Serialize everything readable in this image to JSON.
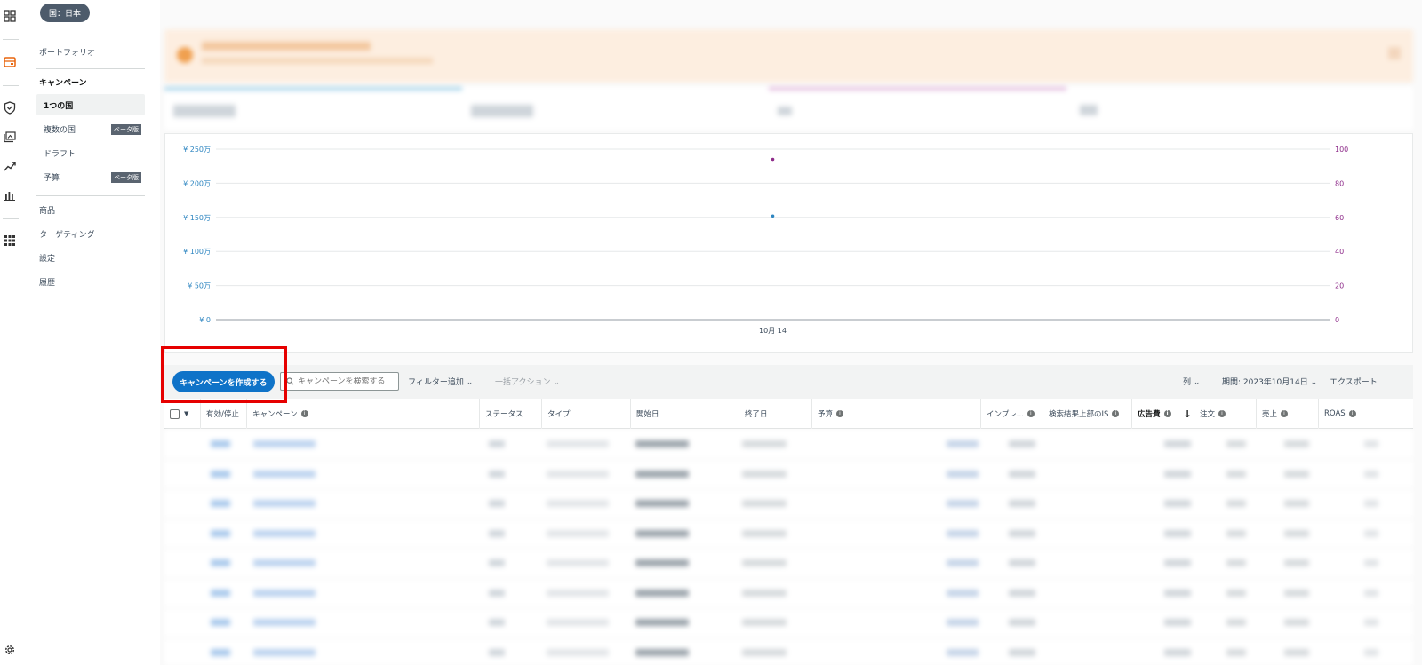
{
  "country_pill": "国：日本",
  "sidebar": {
    "portfolio": "ポートフォリオ",
    "campaign_header": "キャンペーン",
    "single_country": "1つの国",
    "multi_country": "複数の国",
    "beta_badge": "ベータ版",
    "drafts": "ドラフト",
    "budget": "予算",
    "products": "商品",
    "targeting": "ターゲティング",
    "settings": "設定",
    "history": "履歴"
  },
  "rail_icons": [
    "dashboard-icon",
    "campaign-manager-icon",
    "shield-icon",
    "media-icon",
    "trend-icon",
    "bar-chart-icon",
    "apps-grid-icon",
    "gear-icon"
  ],
  "chart_data": {
    "type": "scatter",
    "title": "",
    "xlabel": "",
    "ylabel": "",
    "x": [
      "10月 14"
    ],
    "left_axis_ticks": [
      "¥ 250万",
      "¥ 200万",
      "¥ 150万",
      "¥ 100万",
      "¥ 50万",
      "¥ 0"
    ],
    "right_axis_ticks": [
      "100",
      "80",
      "60",
      "40",
      "20",
      "0"
    ],
    "ylim_left": [
      0,
      2500000
    ],
    "ylim_right": [
      0,
      100
    ],
    "series": [
      {
        "axis": "left",
        "color": "#2e86c1",
        "values": [
          1520000
        ]
      },
      {
        "axis": "right",
        "color": "#8e2c8a",
        "values": [
          94
        ]
      }
    ],
    "grid": true
  },
  "toolbar": {
    "create_label": "キャンペーンを作成する",
    "search_placeholder": "キャンペーンを検索する",
    "add_filter": "フィルター追加",
    "bulk_action": "一括アクション",
    "columns": "列",
    "period": "期間: 2023年10月14日",
    "export": "エクスポート"
  },
  "table": {
    "headers": [
      "有効/停止",
      "キャンペーン",
      "ステータス",
      "タイプ",
      "開始日",
      "終了日",
      "予算",
      "インプレ...",
      "検索結果上部のIS",
      "広告費",
      "注文",
      "売上",
      "ROAS"
    ]
  },
  "colors": {
    "accent": "#0f73c8",
    "highlight_box": "#e60000",
    "left_axis": "#2e86c1",
    "right_axis": "#8e2c8a"
  }
}
